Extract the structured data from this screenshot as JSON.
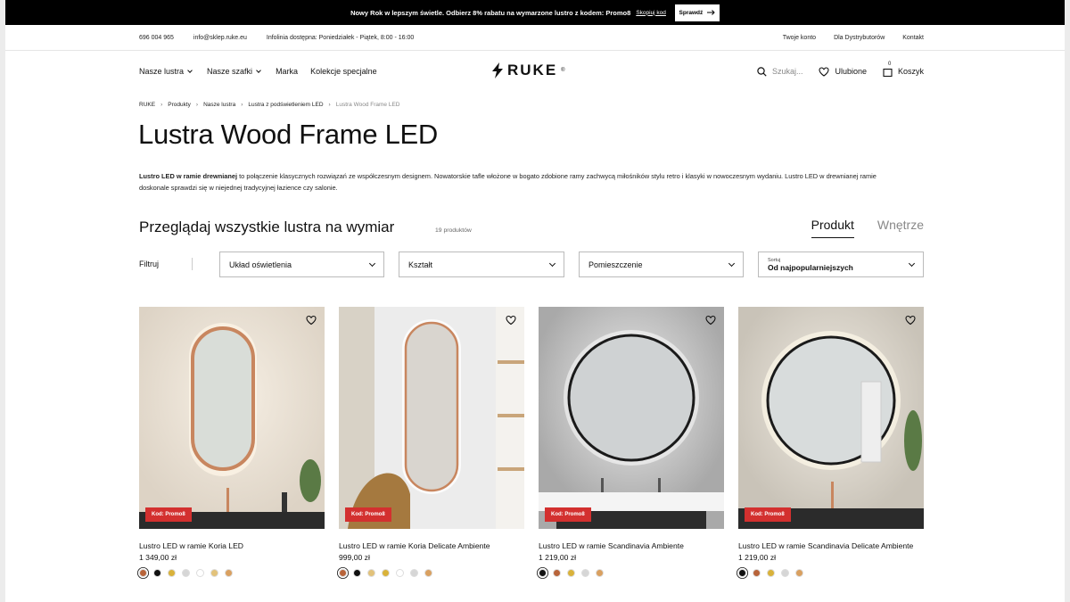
{
  "promo": {
    "text": "Nowy Rok w lepszym świetle. Odbierz 8% rabatu na wymarzone lustro z kodem: Promo8",
    "copy_label": "Skopiuj kod",
    "button_label": "Sprawdź"
  },
  "util": {
    "phone": "696 004 965",
    "email": "info@sklep.ruke.eu",
    "hotline": "Infolinia dostępna: Poniedziałek - Piątek, 8:00 - 16:00",
    "links": [
      "Twoje konto",
      "Dla Dystrybutorów",
      "Kontakt"
    ]
  },
  "nav": {
    "menu": [
      "Nasze lustra",
      "Nasze szafki",
      "Marka",
      "Kolekcje specjalne"
    ],
    "logo": "RUKE",
    "logo_mark": "®",
    "search_placeholder": "Szukaj...",
    "favorites": "Ulubione",
    "cart": "Koszyk",
    "cart_count": "0"
  },
  "breadcrumb": [
    "RUKE",
    "Produkty",
    "Nasze lustra",
    "Lustra z podświetleniem LED",
    "Lustra Wood Frame LED"
  ],
  "page": {
    "title": "Lustra Wood Frame LED",
    "desc_bold": "Lustro LED w ramie drewnianej",
    "desc_rest": " to połączenie klasycznych rozwiązań ze współczesnym designem. Nowatorskie tafle włożone w bogato zdobione ramy zachwycą miłośników stylu retro i klasyki w nowoczesnym wydaniu. Lustro LED w drewnianej ramie doskonale sprawdzi się w niejednej tradycyjnej łazience czy salonie.",
    "browse": "Przeglądaj wszystkie lustra na wymiar",
    "count": "19 produktów",
    "tab_product": "Produkt",
    "tab_interior": "Wnętrze"
  },
  "filters": {
    "label": "Filtruj",
    "f1": "Układ oświetlenia",
    "f2": "Kształt",
    "f3": "Pomieszczenie",
    "sort_label": "Sortuj",
    "sort_value": "Od najpopularniejszych"
  },
  "products": [
    {
      "name": "Lustro LED w ramie Koria LED",
      "price": "1 349,00 zł",
      "badge": "Kod: Promo8",
      "swatches": [
        "#b8643a",
        "#111111",
        "#d9b23a",
        "#d6d6d6",
        "#ffffff",
        "#e2c27a",
        "#d9a060"
      ]
    },
    {
      "name": "Lustro LED w ramie Koria Delicate Ambiente",
      "price": "999,00 zł",
      "badge": "Kod: Promo8",
      "swatches": [
        "#b8643a",
        "#111111",
        "#e2c27a",
        "#d9b23a",
        "#ffffff",
        "#d6d6d6",
        "#d9a060"
      ]
    },
    {
      "name": "Lustro LED w ramie Scandinavia Ambiente",
      "price": "1 219,00 zł",
      "badge": "Kod: Promo8",
      "swatches": [
        "#111111",
        "#b8643a",
        "#d9b23a",
        "#d6d6d6",
        "#d9a060"
      ]
    },
    {
      "name": "Lustro LED w ramie Scandinavia Delicate Ambiente",
      "price": "1 219,00 zł",
      "badge": "Kod: Promo8",
      "swatches": [
        "#111111",
        "#b8643a",
        "#d9b23a",
        "#d6d6d6",
        "#d9a060"
      ]
    }
  ],
  "colors": {
    "promo_bg": "#000000",
    "badge": "#d3302f",
    "accent": "#111111"
  }
}
